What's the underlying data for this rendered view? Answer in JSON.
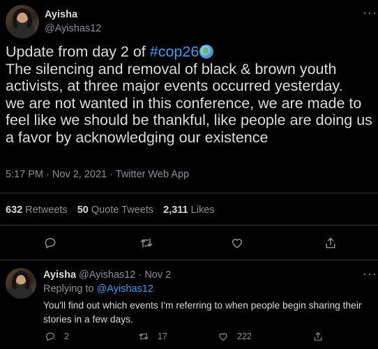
{
  "tweet": {
    "author_name": "Ayisha",
    "author_handle": "@Ayishas12",
    "more_icon": "more-icon",
    "text_prefix": "Update from day 2 of ",
    "hashtag": "#cop26",
    "text_body": "The silencing and removal of black & brown youth activists, at three major events occurred yesterday.\nwe are not wanted in this conference, we are made to feel like we should be thankful, like people are doing us a favor by acknowledging our existence",
    "time": "5:17 PM",
    "sep1": "·",
    "date": "Nov 2, 2021",
    "sep2": "·",
    "source": "Twitter Web App",
    "stats": {
      "retweets_count": "632",
      "retweets_label": "Retweets",
      "quotes_count": "50",
      "quotes_label": "Quote Tweets",
      "likes_count": "2,311",
      "likes_label": "Likes"
    }
  },
  "reply": {
    "author_name": "Ayisha",
    "author_handle": "@Ayishas12",
    "sep": "·",
    "date": "Nov 2",
    "replying_label": "Replying to",
    "replying_to": "@Ayishas12",
    "text": "You'll find out which events I'm referring to when people begin sharing their stories in a few days.",
    "replies": "2",
    "retweets": "17",
    "likes": "222"
  },
  "colors": {
    "background": "#000000",
    "accent": "#3d9cf0",
    "muted": "#8b9096",
    "divider": "#2f3336"
  }
}
